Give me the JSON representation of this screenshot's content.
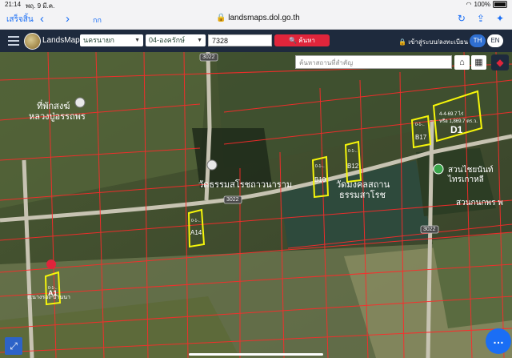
{
  "status_bar": {
    "time": "21:14",
    "date": "พฤ. 9 มี.ค.",
    "battery": "100%"
  },
  "browser": {
    "done_label": "เสร็จสิ้น",
    "aa_label": "กก",
    "url": "landsmaps.dol.go.th"
  },
  "app": {
    "brand": "LandsMaps",
    "province": "นครนายก",
    "district": "04-องครักษ์",
    "parcel_number": "7328",
    "search_label": "ค้นหา",
    "login_label": "เข้าสู่ระบบ/ลงทะเบียน",
    "lang_th": "TH",
    "lang_en": "EN"
  },
  "map": {
    "place_search_placeholder": "ค้นหาสถานที่สำคัญ",
    "labels": {
      "place1_line1": "ที่พักสงฆ์",
      "place1_line2": "หลวงปู่อรรถพร",
      "temple1": "วัดธรรมสโรชถาวนาราม",
      "temple2_line1": "วัดมงคลสถาน",
      "temple2_line2": "ธรรมสาโรช",
      "shop_line1": "สวนไชยนันท์",
      "shop_line2": "ไทรเกาหลี",
      "shop2": "สวนกนกพร พ",
      "road_bottom": "ถ.นางรอง-บ้านนา",
      "road_3022_a": "3022",
      "road_3022_b": "3022",
      "road_3022_c": "3022"
    },
    "parcels": {
      "a1": {
        "id": "A1",
        "area": "0-1-.."
      },
      "a14": {
        "id": "A14",
        "area": "0-1-.."
      },
      "b10": {
        "id": "B10",
        "area": "0-1-.."
      },
      "b12": {
        "id": "B12",
        "area": "0-1-.."
      },
      "b17": {
        "id": "B17",
        "area": "0-1-.."
      },
      "d1": {
        "id": "D1",
        "area_line": "4-4-69.7 ไร่",
        "note_line": "หรือ 1,869.7 ตร.ว."
      }
    }
  },
  "colors": {
    "header_bg": "#1e2a3d",
    "search_red": "#e0253b",
    "parcel_line": "#ff2a2a",
    "highlight": "#f5f50a",
    "ios_blue": "#1a6ef5"
  }
}
